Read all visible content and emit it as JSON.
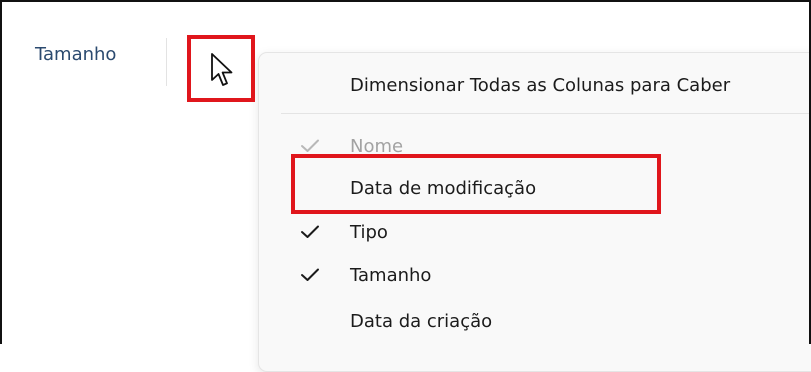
{
  "header": {
    "column_label": "Tamanho"
  },
  "cursor": {
    "icon": "mouse-pointer-icon"
  },
  "context_menu": {
    "top_item": {
      "label": "Dimensionar Todas as Colunas para Caber"
    },
    "items": [
      {
        "label": "Nome",
        "checked": true,
        "disabled": true
      },
      {
        "label": "Data de modificação",
        "checked": false,
        "disabled": false
      },
      {
        "label": "Tipo",
        "checked": true,
        "disabled": false
      },
      {
        "label": "Tamanho",
        "checked": true,
        "disabled": false
      },
      {
        "label": "Data da criação",
        "checked": false,
        "disabled": false
      }
    ]
  },
  "colors": {
    "highlight": "#e0161c",
    "header_text": "#2b4a6f",
    "menu_background": "#f9f9f9",
    "disabled_text": "#a2a2a2"
  }
}
